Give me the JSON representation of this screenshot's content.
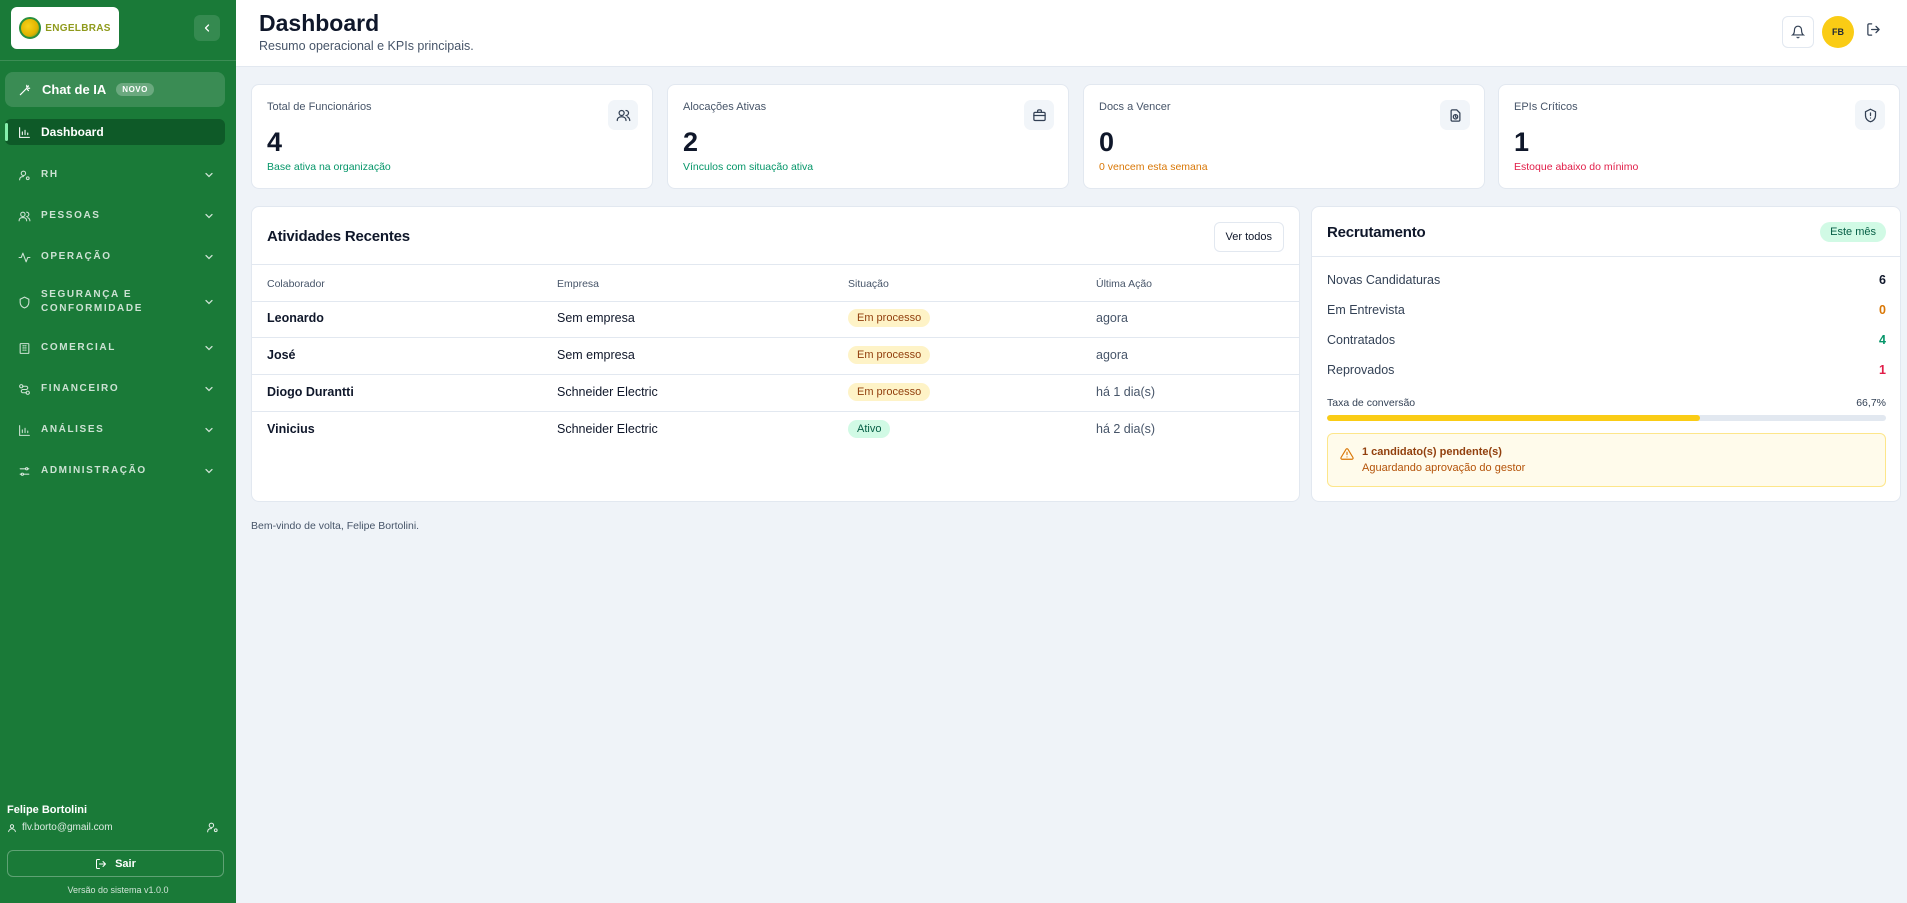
{
  "brand": {
    "logo_text": "ENGELBRAS"
  },
  "sidebar": {
    "chat": {
      "label": "Chat de IA",
      "badge": "NOVO"
    },
    "dashboard": {
      "label": "Dashboard"
    },
    "groups": [
      {
        "label": "RH",
        "icon": "user-gear-icon"
      },
      {
        "label": "PESSOAS",
        "icon": "users-icon"
      },
      {
        "label": "OPERAÇÃO",
        "icon": "activity-icon"
      },
      {
        "label": "SEGURANÇA E CONFORMIDADE",
        "line1": "SEGURANÇA E",
        "line2": "CONFORMIDADE",
        "icon": "shield-icon"
      },
      {
        "label": "COMERCIAL",
        "icon": "building-icon"
      },
      {
        "label": "FINANCEIRO",
        "icon": "route-icon"
      },
      {
        "label": "ANÁLISES",
        "icon": "bar-chart-icon"
      },
      {
        "label": "ADMINISTRAÇÃO",
        "icon": "sliders-icon"
      }
    ],
    "user": {
      "name": "Felipe Bortolini",
      "email": "flv.borto@gmail.com"
    },
    "logout_label": "Sair",
    "version": "Versão do sistema v1.0.0"
  },
  "header": {
    "title": "Dashboard",
    "subtitle": "Resumo operacional e KPIs principais.",
    "avatar_initials": "FB"
  },
  "kpis": [
    {
      "label": "Total de Funcionários",
      "value": "4",
      "sub": "Base ativa na organização",
      "sub_color": "#059669",
      "icon": "users-icon"
    },
    {
      "label": "Alocações Ativas",
      "value": "2",
      "sub": "Vínculos com situação ativa",
      "sub_color": "#059669",
      "icon": "briefcase-icon"
    },
    {
      "label": "Docs a Vencer",
      "value": "0",
      "sub": "0 vencem esta semana",
      "sub_color": "#d97706",
      "icon": "document-clock-icon"
    },
    {
      "label": "EPIs Críticos",
      "value": "1",
      "sub": "Estoque abaixo do mínimo",
      "sub_color": "#e11d48",
      "icon": "shield-alert-icon"
    }
  ],
  "activities": {
    "title": "Atividades Recentes",
    "view_all": "Ver todos",
    "columns": [
      "Colaborador",
      "Empresa",
      "Situação",
      "Última Ação"
    ],
    "rows": [
      {
        "name": "Leonardo",
        "company": "Sem empresa",
        "status": "Em processo",
        "status_kind": "warn",
        "last": "agora"
      },
      {
        "name": "José",
        "company": "Sem empresa",
        "status": "Em processo",
        "status_kind": "warn",
        "last": "agora"
      },
      {
        "name": "Diogo Durantti",
        "company": "Schneider Electric",
        "status": "Em processo",
        "status_kind": "warn",
        "last": "há 1 dia(s)"
      },
      {
        "name": "Vinicius",
        "company": "Schneider Electric",
        "status": "Ativo",
        "status_kind": "ok",
        "last": "há 2 dia(s)"
      }
    ]
  },
  "recruitment": {
    "title": "Recrutamento",
    "period": "Este mês",
    "stats": [
      {
        "label": "Novas Candidaturas",
        "value": "6",
        "color": "#0f172a"
      },
      {
        "label": "Em Entrevista",
        "value": "0",
        "color": "#d97706"
      },
      {
        "label": "Contratados",
        "value": "4",
        "color": "#059669"
      },
      {
        "label": "Reprovados",
        "value": "1",
        "color": "#e11d48"
      }
    ],
    "conversion_label": "Taxa de conversão",
    "conversion_value": "66,7%",
    "conversion_fraction": 0.667,
    "alert_title": "1 candidato(s) pendente(s)",
    "alert_sub": "Aguardando aprovação do gestor"
  },
  "footer": {
    "welcome": "Bem-vindo de volta, Felipe Bortolini."
  },
  "colors": {
    "sidebar": "#1a7a38",
    "accent_yellow": "#facc15"
  }
}
